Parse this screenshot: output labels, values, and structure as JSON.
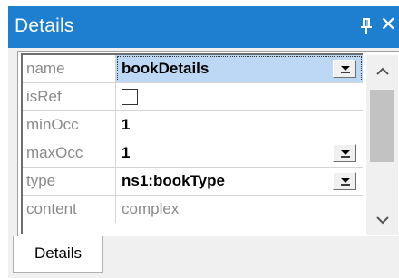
{
  "window": {
    "title": "Details",
    "pin_icon": "pin-icon",
    "close_glyph": "✕"
  },
  "grid": {
    "rows": [
      {
        "prop": "name",
        "value": "bookDetails",
        "control": "dropdown",
        "selected": true
      },
      {
        "prop": "isRef",
        "value": "",
        "control": "checkbox",
        "checked": false
      },
      {
        "prop": "minOcc",
        "value": "1",
        "control": "text"
      },
      {
        "prop": "maxOcc",
        "value": "1",
        "control": "dropdown"
      },
      {
        "prop": "type",
        "value": "ns1:bookType",
        "control": "dropdown"
      },
      {
        "prop": "content",
        "value": "complex",
        "control": "readonly"
      }
    ]
  },
  "scrollbar": {
    "up_glyph": "⌃",
    "down_glyph": "⌄"
  },
  "tabs": [
    {
      "label": "Details",
      "active": true
    }
  ],
  "colors": {
    "titlebar": "#1e7ecf",
    "selection": "#bcd8f4",
    "prop_text": "#8a8a8a"
  }
}
